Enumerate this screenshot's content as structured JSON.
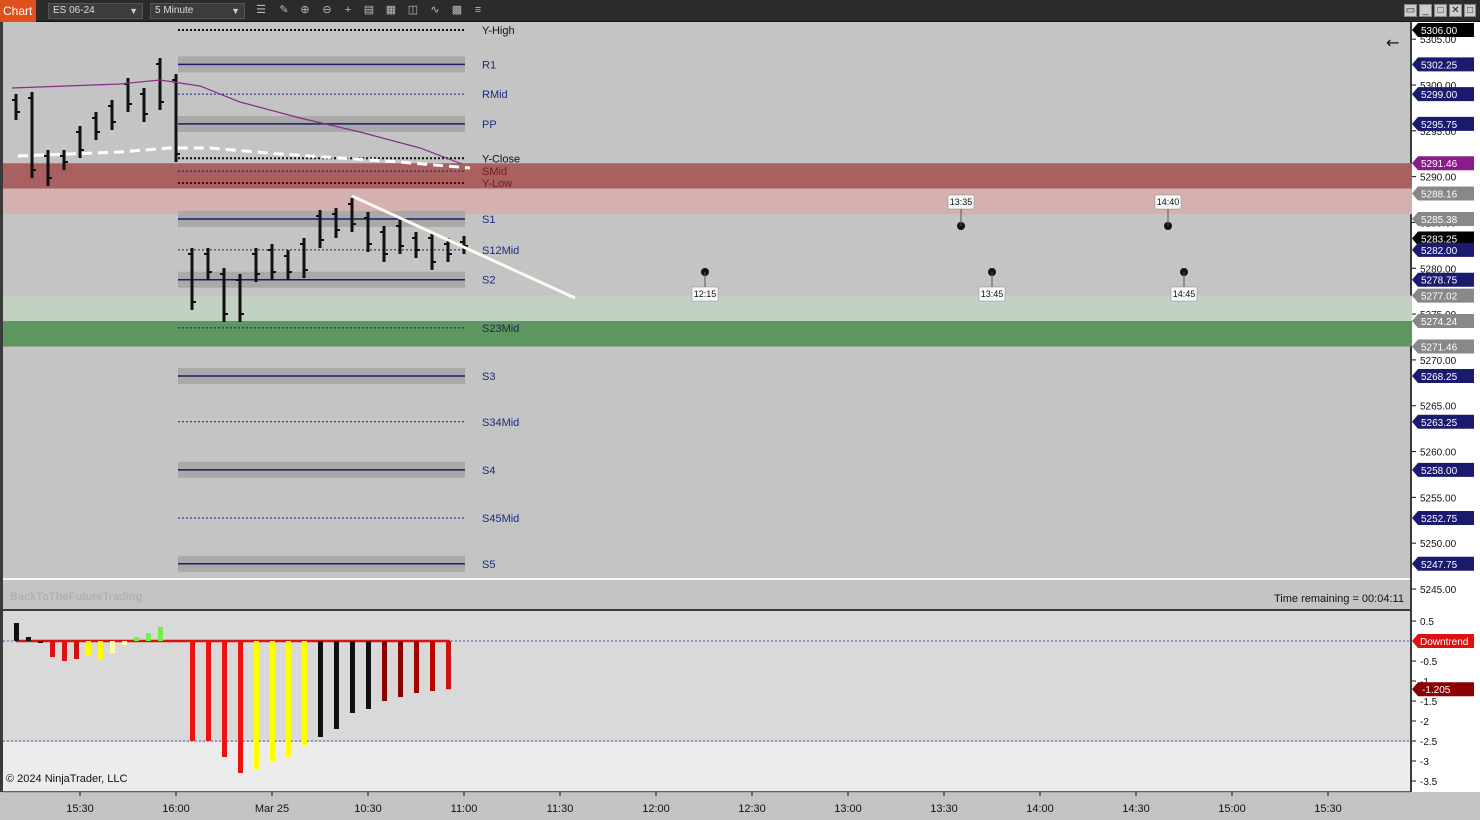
{
  "toolbar": {
    "tab_label": "Chart",
    "instrument": "ES 06-24",
    "interval": "5 Minute",
    "icons": [
      "bar-style-icon",
      "draw-tool-icon",
      "zoom-in-icon",
      "zoom-out-icon",
      "crosshair-icon",
      "data-box-icon",
      "templates-icon",
      "indicators-icon",
      "strategies-icon",
      "properties-icon",
      "menu-icon"
    ],
    "window_buttons": [
      "restore-icon",
      "minimize-icon",
      "maximize-icon",
      "close-icon"
    ]
  },
  "price_axis": {
    "ticks": [
      "5305.00",
      "5300.00",
      "5295.00",
      "5290.00",
      "5285.00",
      "5280.00",
      "5275.00",
      "5270.00",
      "5265.00",
      "5260.00",
      "5255.00",
      "5250.00",
      "5245.00"
    ],
    "tags": [
      {
        "text": "5306.00",
        "color": "#000000",
        "price": 5306.0
      },
      {
        "text": "5302.25",
        "color": "#1a1a6e",
        "price": 5302.25
      },
      {
        "text": "5299.00",
        "color": "#1a1a6e",
        "price": 5299.0
      },
      {
        "text": "5295.75",
        "color": "#1a1a6e",
        "price": 5295.75
      },
      {
        "text": "5291.46",
        "color": "#8b1a8b",
        "price": 5291.46
      },
      {
        "text": "5288.16",
        "color": "#888888",
        "price": 5288.16
      },
      {
        "text": "5285.38",
        "color": "#888888",
        "price": 5285.38
      },
      {
        "text": "5283.25",
        "color": "#000000",
        "price": 5283.25
      },
      {
        "text": "5282.00",
        "color": "#1a1a6e",
        "price": 5282.0
      },
      {
        "text": "5278.75",
        "color": "#1a1a6e",
        "price": 5278.75
      },
      {
        "text": "5277.02",
        "color": "#888888",
        "price": 5277.02
      },
      {
        "text": "5274.24",
        "color": "#888888",
        "price": 5274.24
      },
      {
        "text": "5271.46",
        "color": "#888888",
        "price": 5271.46
      },
      {
        "text": "5268.25",
        "color": "#1a1a6e",
        "price": 5268.25
      },
      {
        "text": "5263.25",
        "color": "#1a1a6e",
        "price": 5263.25
      },
      {
        "text": "5258.00",
        "color": "#1a1a6e",
        "price": 5258.0
      },
      {
        "text": "5252.75",
        "color": "#1a1a6e",
        "price": 5252.75
      },
      {
        "text": "5247.75",
        "color": "#1a1a6e",
        "price": 5247.75
      }
    ]
  },
  "levels": [
    {
      "name": "Y-High",
      "price": 5306.0,
      "style": "dotted",
      "color": "#111111",
      "label_color": "#111111"
    },
    {
      "name": "R1",
      "price": 5302.25,
      "style": "solid",
      "color": "#1a1a6e",
      "label_color": "#1a2a80"
    },
    {
      "name": "RMid",
      "price": 5299.0,
      "style": "dashed",
      "color": "#1a1a6e",
      "label_color": "#1a2a80"
    },
    {
      "name": "PP",
      "price": 5295.75,
      "style": "solid",
      "color": "#1a1a6e",
      "label_color": "#1a2a80"
    },
    {
      "name": "Y-Close",
      "price": 5292.0,
      "style": "dotted",
      "color": "#111111",
      "label_color": "#111111"
    },
    {
      "name": "SMid",
      "price": 5290.6,
      "style": "dashed",
      "color": "#1a1a6e",
      "label_color": "#7a1a1a"
    },
    {
      "name": "Y-Low",
      "price": 5289.3,
      "style": "dotted",
      "color": "#5a0000",
      "label_color": "#7a1a1a"
    },
    {
      "name": "S1",
      "price": 5285.38,
      "style": "solid",
      "color": "#1a1a6e",
      "label_color": "#1a2a80"
    },
    {
      "name": "S12Mid",
      "price": 5282.0,
      "style": "dashed",
      "color": "#1a1a6e",
      "label_color": "#1a2a80"
    },
    {
      "name": "S2",
      "price": 5278.75,
      "style": "solid",
      "color": "#1a1a6e",
      "label_color": "#1a2a80"
    },
    {
      "name": "S23Mid",
      "price": 5273.5,
      "style": "dashed",
      "color": "#1a1a6e",
      "label_color": "#1a2a50"
    },
    {
      "name": "S3",
      "price": 5268.25,
      "style": "solid",
      "color": "#1a1a6e",
      "label_color": "#1a2a80"
    },
    {
      "name": "S34Mid",
      "price": 5263.25,
      "style": "dashed",
      "color": "#1a1a6e",
      "label_color": "#1a2a80"
    },
    {
      "name": "S4",
      "price": 5258.0,
      "style": "solid",
      "color": "#1a1a6e",
      "label_color": "#1a2a80"
    },
    {
      "name": "S45Mid",
      "price": 5252.75,
      "style": "dashed",
      "color": "#1a1a6e",
      "label_color": "#1a2a80"
    },
    {
      "name": "S5",
      "price": 5247.75,
      "style": "solid",
      "color": "#1a1a6e",
      "label_color": "#1a2a80"
    }
  ],
  "zones": [
    {
      "name": "resistance-zone-dark",
      "top": 5291.46,
      "bottom": 5288.7,
      "color": "#a86060"
    },
    {
      "name": "resistance-zone-light",
      "top": 5288.7,
      "bottom": 5285.9,
      "color": "#d4b0b0"
    },
    {
      "name": "support-zone-light",
      "top": 5277.02,
      "bottom": 5274.24,
      "color": "#c2d2c2"
    },
    {
      "name": "support-zone-dark",
      "top": 5274.24,
      "bottom": 5271.46,
      "color": "#5e9660"
    }
  ],
  "time_markers": [
    {
      "label": "12:15",
      "x_slot": 12.15,
      "position": "below"
    },
    {
      "label": "13:35",
      "x_slot": 13.35,
      "position": "above"
    },
    {
      "label": "13:45",
      "x_slot": 13.45,
      "position": "below"
    },
    {
      "label": "14:40",
      "x_slot": 14.4,
      "position": "above"
    },
    {
      "label": "14:45",
      "x_slot": 14.45,
      "position": "below"
    }
  ],
  "time_axis": [
    "15:30",
    "16:00",
    "Mar 25",
    "10:30",
    "11:00",
    "11:30",
    "12:00",
    "12:30",
    "13:00",
    "13:30",
    "14:00",
    "14:30",
    "15:00",
    "15:30"
  ],
  "watermark": "BackToTheFutureTrading",
  "time_remaining": "Time remaining = 00:04:11",
  "copyright": "© 2024 NinjaTrader, LLC",
  "oscillator": {
    "ticks": [
      "0.5",
      "-0.5",
      "-1",
      "-1.5",
      "-2",
      "-2.5",
      "-3",
      "-3.5"
    ],
    "status_label": "Downtrend",
    "value_label": "-1.205",
    "values": [
      0.45,
      0.1,
      -0.05,
      -0.4,
      -0.5,
      -0.45,
      -0.35,
      -0.45,
      -0.3,
      -0.1,
      0.1,
      0.2,
      0.35,
      -2.5,
      -2.5,
      -2.9,
      -3.3,
      -3.2,
      -3.0,
      -2.9,
      -2.6,
      -2.4,
      -2.2,
      -1.8,
      -1.7,
      -1.5,
      -1.4,
      -1.3,
      -1.25,
      -1.205
    ],
    "colors": [
      "#111111",
      "#111111",
      "#111111",
      "#dd1111",
      "#dd1111",
      "#cc1111",
      "#ffff00",
      "#ffff00",
      "#ffffaa",
      "#ffffaa",
      "#77ee44",
      "#77ee44",
      "#77ee44",
      "#ee1111",
      "#ee1111",
      "#ee1111",
      "#ee1111",
      "#ffff00",
      "#ffff00",
      "#ffff00",
      "#ffff00",
      "#111111",
      "#111111",
      "#111111",
      "#111111",
      "#8b0000",
      "#8b0000",
      "#a00000",
      "#bb0000",
      "#cc1111"
    ]
  }
}
